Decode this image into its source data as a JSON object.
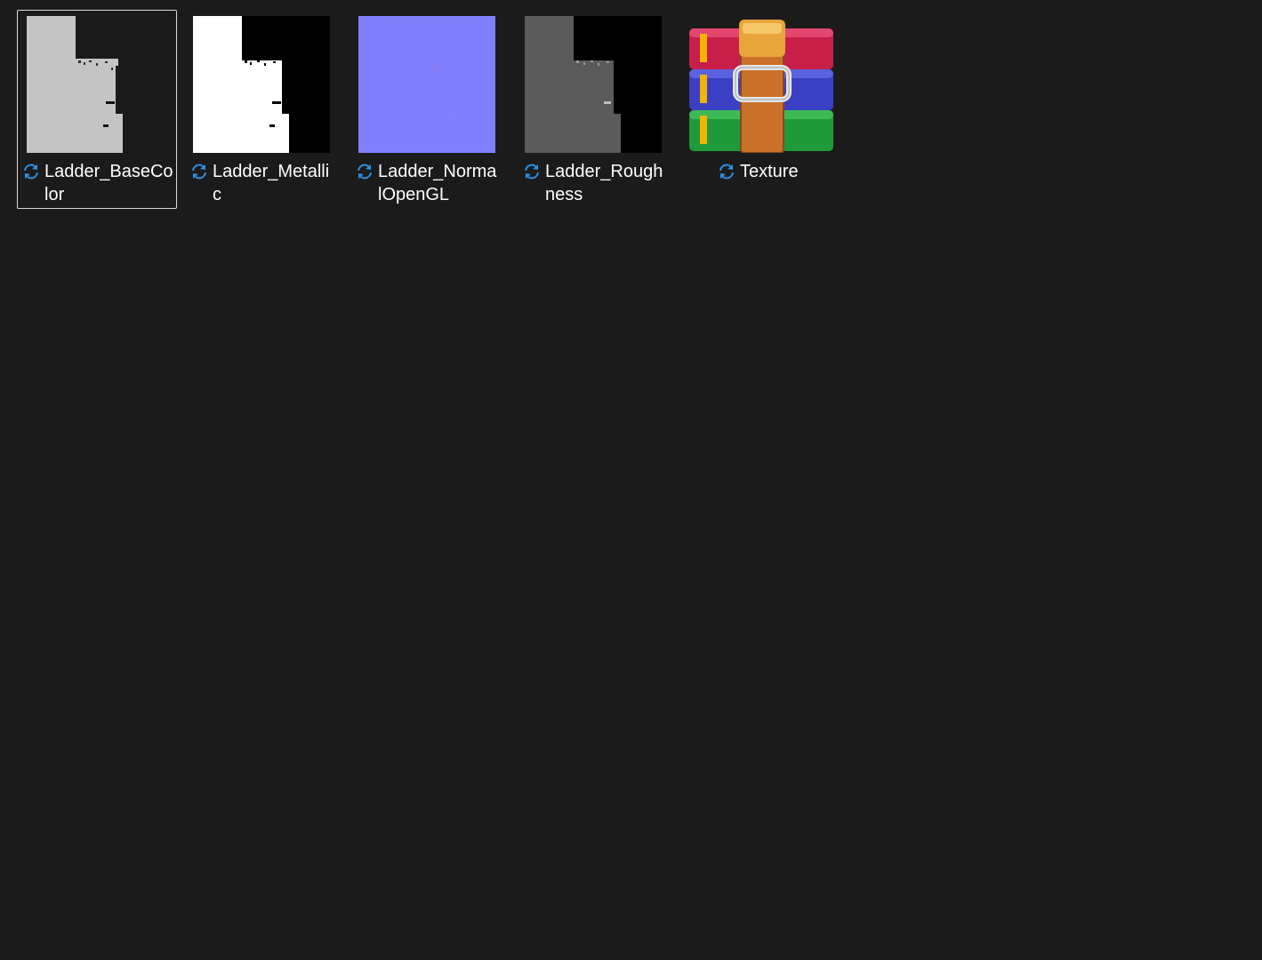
{
  "files": [
    {
      "name": "Ladder_BaseColor",
      "line1": "Ladder_BaseCo",
      "line2": "lor",
      "selected": true,
      "thumb": "basecolor-thumbnail",
      "status_icon": "sync-icon"
    },
    {
      "name": "Ladder_Metallic",
      "line1": "Ladder_Metalli",
      "line2": "c",
      "selected": false,
      "thumb": "metallic-thumbnail",
      "status_icon": "sync-icon"
    },
    {
      "name": "Ladder_NormalOpenGL",
      "line1": "Ladder_Norma",
      "line2": "lOpenGL",
      "selected": false,
      "thumb": "normal-map-thumbnail",
      "status_icon": "sync-icon"
    },
    {
      "name": "Ladder_Roughness",
      "line1": "Ladder_Rough",
      "line2": "ness",
      "selected": false,
      "thumb": "roughness-thumbnail",
      "status_icon": "sync-icon"
    },
    {
      "name": "Texture",
      "line1": "Texture",
      "line2": "",
      "selected": false,
      "thumb": "winrar-archive-icon",
      "status_icon": "sync-icon"
    }
  ],
  "colors": {
    "background": "#1b1b1b",
    "text": "#ffffff",
    "sync_icon": "#2b8fe0",
    "selection_border": "#d9d9d9",
    "normal_map": "#8080ff"
  }
}
